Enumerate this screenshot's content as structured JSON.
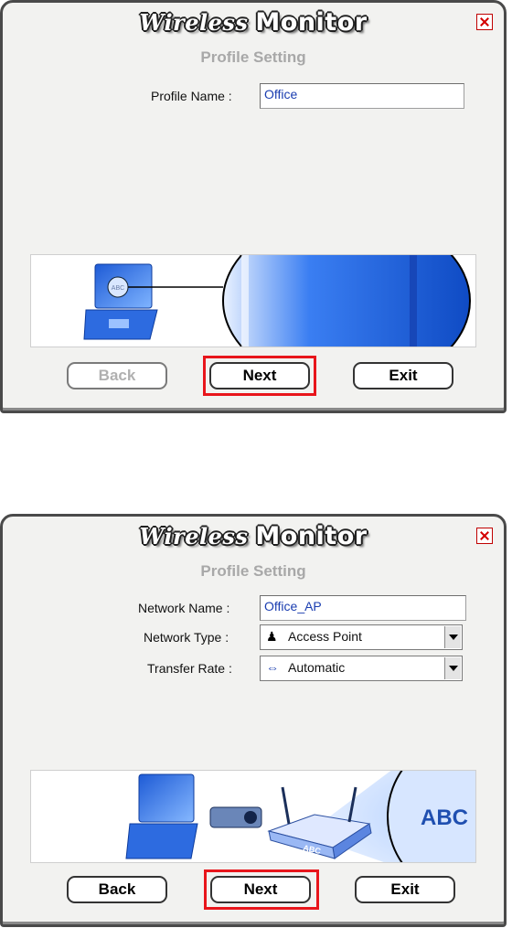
{
  "colors": {
    "highlight": "#e8151b",
    "field_text": "#1a3db0",
    "subtitle": "#a8a8a8"
  },
  "screens": [
    {
      "title": {
        "part1": "Wireless",
        "part2": "Monitor"
      },
      "subtitle": "Profile Setting",
      "fields": {
        "profile_name_label": "Profile Name :",
        "profile_name_value": "Office"
      },
      "buttons": {
        "back": "Back",
        "next": "Next",
        "exit": "Exit"
      },
      "back_enabled": false,
      "banner_text": "ABC"
    },
    {
      "title": {
        "part1": "Wireless",
        "part2": "Monitor"
      },
      "subtitle": "Profile Setting",
      "fields": {
        "network_name_label": "Network Name :",
        "network_name_value": "Office_AP",
        "network_type_label": "Network Type :",
        "network_type_value": "Access Point",
        "network_type_icon": "person-icon",
        "transfer_rate_label": "Transfer Rate :",
        "transfer_rate_value": "Automatic",
        "transfer_rate_icon": "double-arrow-icon"
      },
      "buttons": {
        "back": "Back",
        "next": "Next",
        "exit": "Exit"
      },
      "back_enabled": true,
      "banner_text": "ABC",
      "router_label": "ABC"
    }
  ]
}
